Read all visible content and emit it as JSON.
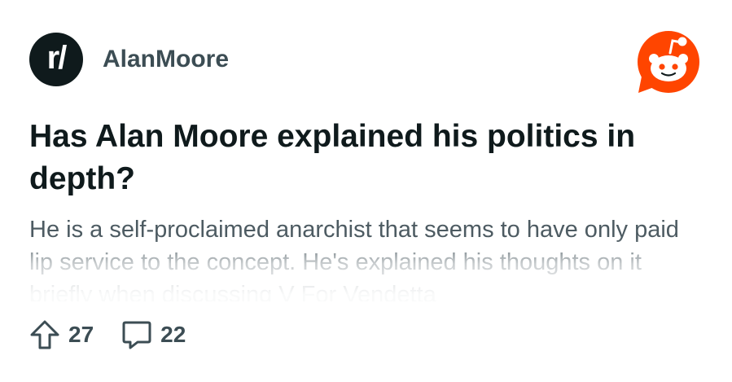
{
  "subreddit": {
    "icon_text": "r/",
    "name": "AlanMoore"
  },
  "brand": {
    "icon": "reddit-snoo-icon",
    "color": "#ff4500"
  },
  "post": {
    "title": "Has Alan Moore explained his politics in depth?",
    "body": "He is a self-proclaimed anarchist that seems to have only paid lip service to the concept. He's explained his thoughts on it briefly when discussing V For Vendetta"
  },
  "stats": {
    "upvotes": "27",
    "comments": "22",
    "upvote_icon": "upvote-arrow-icon",
    "comment_icon": "comment-bubble-icon"
  }
}
